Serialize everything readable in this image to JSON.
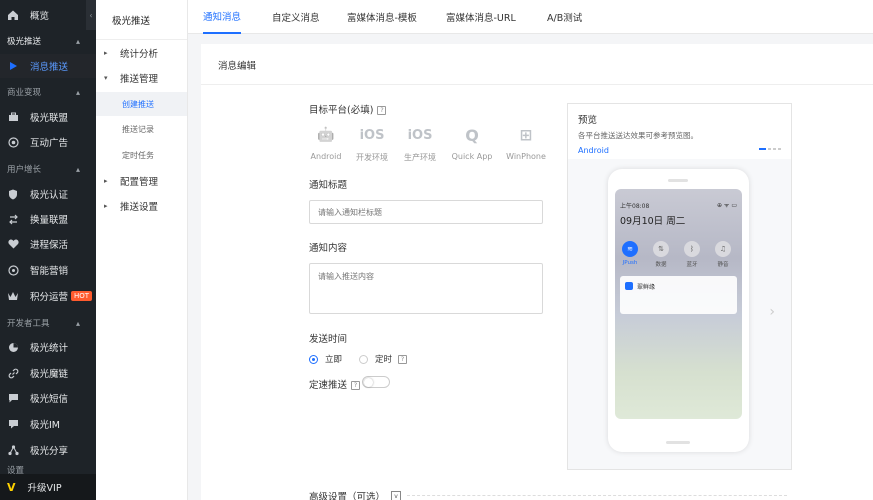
{
  "sidebar": {
    "overview": "概览",
    "sections": [
      {
        "label": "极光推送"
      },
      {
        "label": "商业变现"
      },
      {
        "label": "用户增长"
      },
      {
        "label": "开发者工具"
      },
      {
        "label": "设置"
      }
    ],
    "items": [
      {
        "label": "消息推送",
        "icon": "play-icon",
        "active": true
      },
      {
        "label": "极光联盟",
        "icon": "briefcase-icon"
      },
      {
        "label": "互动广告",
        "icon": "target-icon"
      },
      {
        "label": "极光认证",
        "icon": "shield-icon"
      },
      {
        "label": "换量联盟",
        "icon": "swap-icon"
      },
      {
        "label": "进程保活",
        "icon": "heart-icon"
      },
      {
        "label": "智能营销",
        "icon": "radar-icon"
      },
      {
        "label": "积分运营",
        "icon": "crown-icon",
        "badge": "HOT"
      },
      {
        "label": "极光统计",
        "icon": "pie-icon"
      },
      {
        "label": "极光魔链",
        "icon": "link-icon"
      },
      {
        "label": "极光短信",
        "icon": "message-icon"
      },
      {
        "label": "极光IM",
        "icon": "chat-icon"
      },
      {
        "label": "极光分享",
        "icon": "share-icon"
      }
    ],
    "vip": "升级VIP",
    "collapse_glyph": "‹"
  },
  "submenu": {
    "title": "极光推送",
    "items": [
      {
        "label": "统计分析",
        "arrow": "▸"
      },
      {
        "label": "推送管理",
        "arrow": "▾"
      },
      {
        "label": "配置管理",
        "arrow": "▸"
      },
      {
        "label": "推送设置",
        "arrow": "▸"
      }
    ],
    "children": [
      {
        "label": "创建推送",
        "active": true
      },
      {
        "label": "推送记录"
      },
      {
        "label": "定时任务"
      }
    ]
  },
  "tabs": [
    {
      "label": "通知消息",
      "active": true
    },
    {
      "label": "自定义消息"
    },
    {
      "label": "富媒体消息-模板"
    },
    {
      "label": "富媒体消息-URL"
    },
    {
      "label": "A/B测试"
    }
  ],
  "panel": {
    "title": "消息编辑",
    "target_label": "目标平台(必填)",
    "platforms": [
      {
        "label": "Android",
        "glyph": "🤖"
      },
      {
        "label": "开发环境",
        "glyph": "iOS"
      },
      {
        "label": "生产环境",
        "glyph": "iOS"
      },
      {
        "label": "Quick App",
        "glyph": "Q"
      },
      {
        "label": "WinPhone",
        "glyph": "⊞"
      }
    ],
    "notif_title_label": "通知标题",
    "notif_title_placeholder": "请输入通知栏标题",
    "notif_content_label": "通知内容",
    "notif_content_placeholder": "请输入推送内容",
    "send_time_label": "发送时间",
    "send_now": "立即",
    "send_scheduled": "定时",
    "speed_label": "定速推送",
    "advanced_label": "高级设置（可选）",
    "help_glyph": "?",
    "advanced_glyph": "v"
  },
  "preview": {
    "title": "预览",
    "subtitle": "各平台推送送达效果可参考预览图。",
    "platform": "Android",
    "time": "上午08:08",
    "status": "⊕ ᯤ ▭",
    "date": "09月10日  周二",
    "controls": [
      {
        "label": "JPush",
        "glyph": "≋"
      },
      {
        "label": "数据",
        "glyph": "⇅"
      },
      {
        "label": "蓝牙",
        "glyph": "ᛒ"
      },
      {
        "label": "静音",
        "glyph": "♫"
      }
    ],
    "notification_app": "翠鲜缘",
    "next_glyph": "›"
  },
  "colors": {
    "accent": "#1e6fff",
    "sidebar_bg": "#1e2328",
    "highlight": "#ffd200",
    "hot": "#ff5b2e"
  }
}
